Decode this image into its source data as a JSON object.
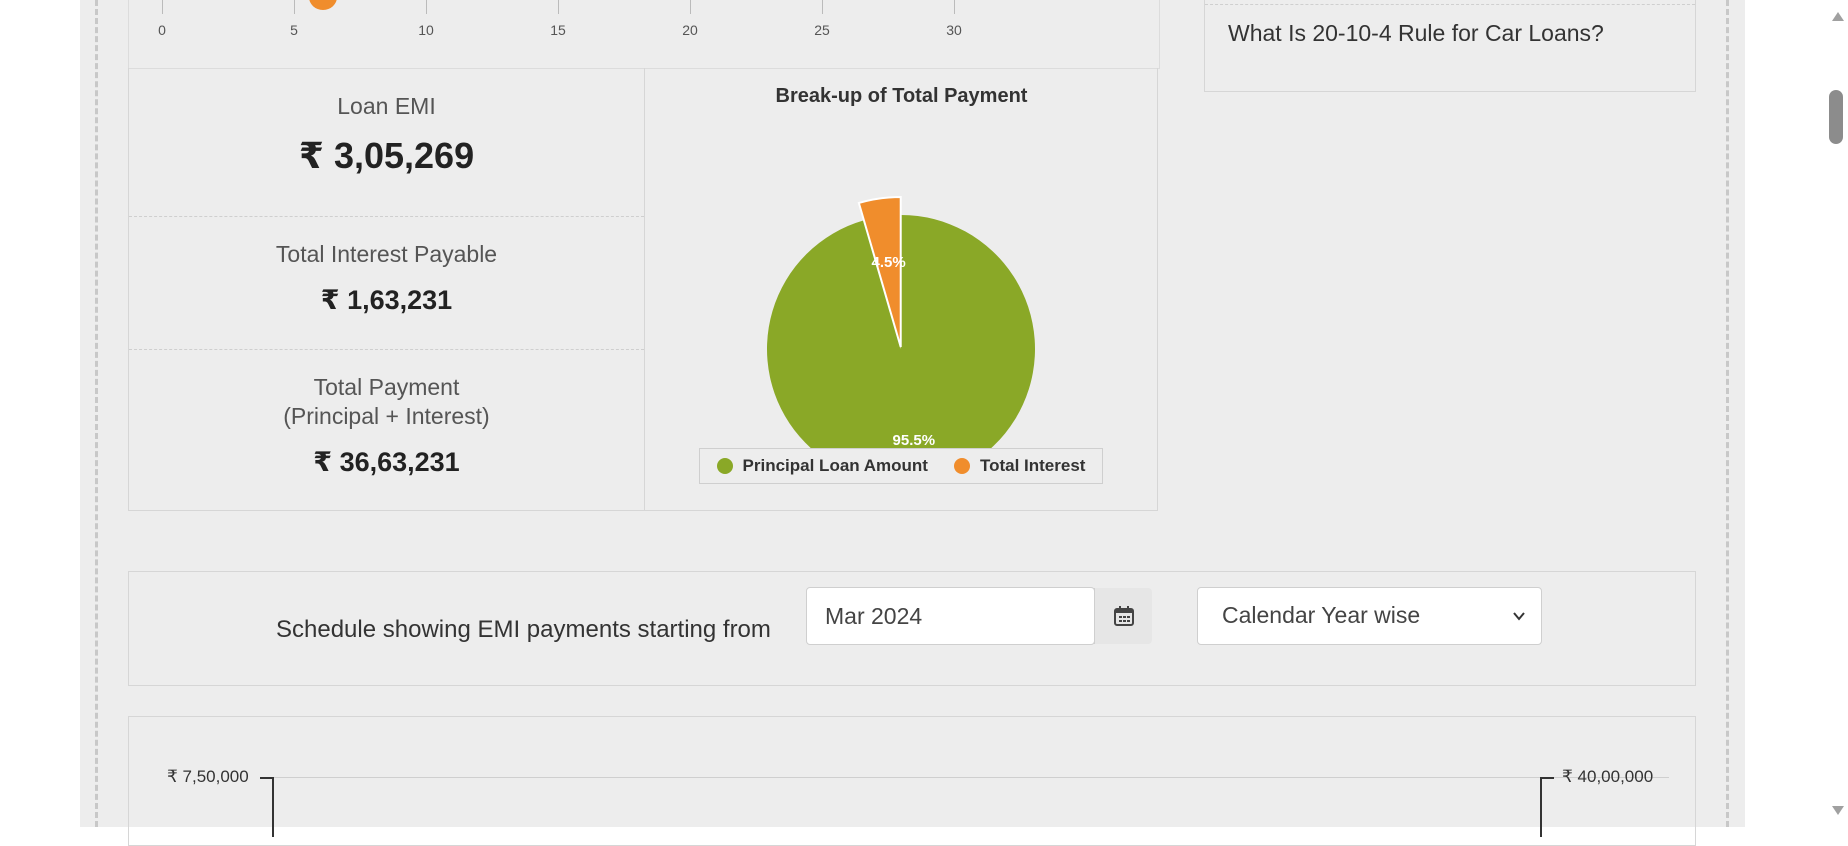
{
  "slider_axis": {
    "ticks": [
      "0",
      "5",
      "10",
      "15",
      "20",
      "25",
      "30"
    ]
  },
  "results": {
    "emi_label": "Loan EMI",
    "emi_value": "₹ 3,05,269",
    "interest_label": "Total Interest Payable",
    "interest_value": "₹ 1,63,231",
    "payment_label_line1": "Total Payment",
    "payment_label_line2": "(Principal + Interest)",
    "payment_value": "₹ 36,63,231"
  },
  "chart_data": {
    "type": "pie",
    "title": "Break-up of Total Payment",
    "categories": [
      "Principal Loan Amount",
      "Total Interest"
    ],
    "values": [
      95.5,
      4.5
    ],
    "data_labels": [
      "95.5%",
      "4.5%"
    ],
    "colors": [
      "#8aa827",
      "#f08d2c"
    ],
    "legend_placement": "bottom"
  },
  "faq": {
    "link_text": "What Is 20-10-4 Rule for Car Loans?"
  },
  "schedule": {
    "label": "Schedule showing EMI payments starting from",
    "date_value": "Mar 2024",
    "calendar_icon": "calendar-icon",
    "view_selected": "Calendar Year wise"
  },
  "bottom_chart": {
    "left_axis_max": "₹ 7,50,000",
    "right_axis_max": "₹ 40,00,000"
  }
}
